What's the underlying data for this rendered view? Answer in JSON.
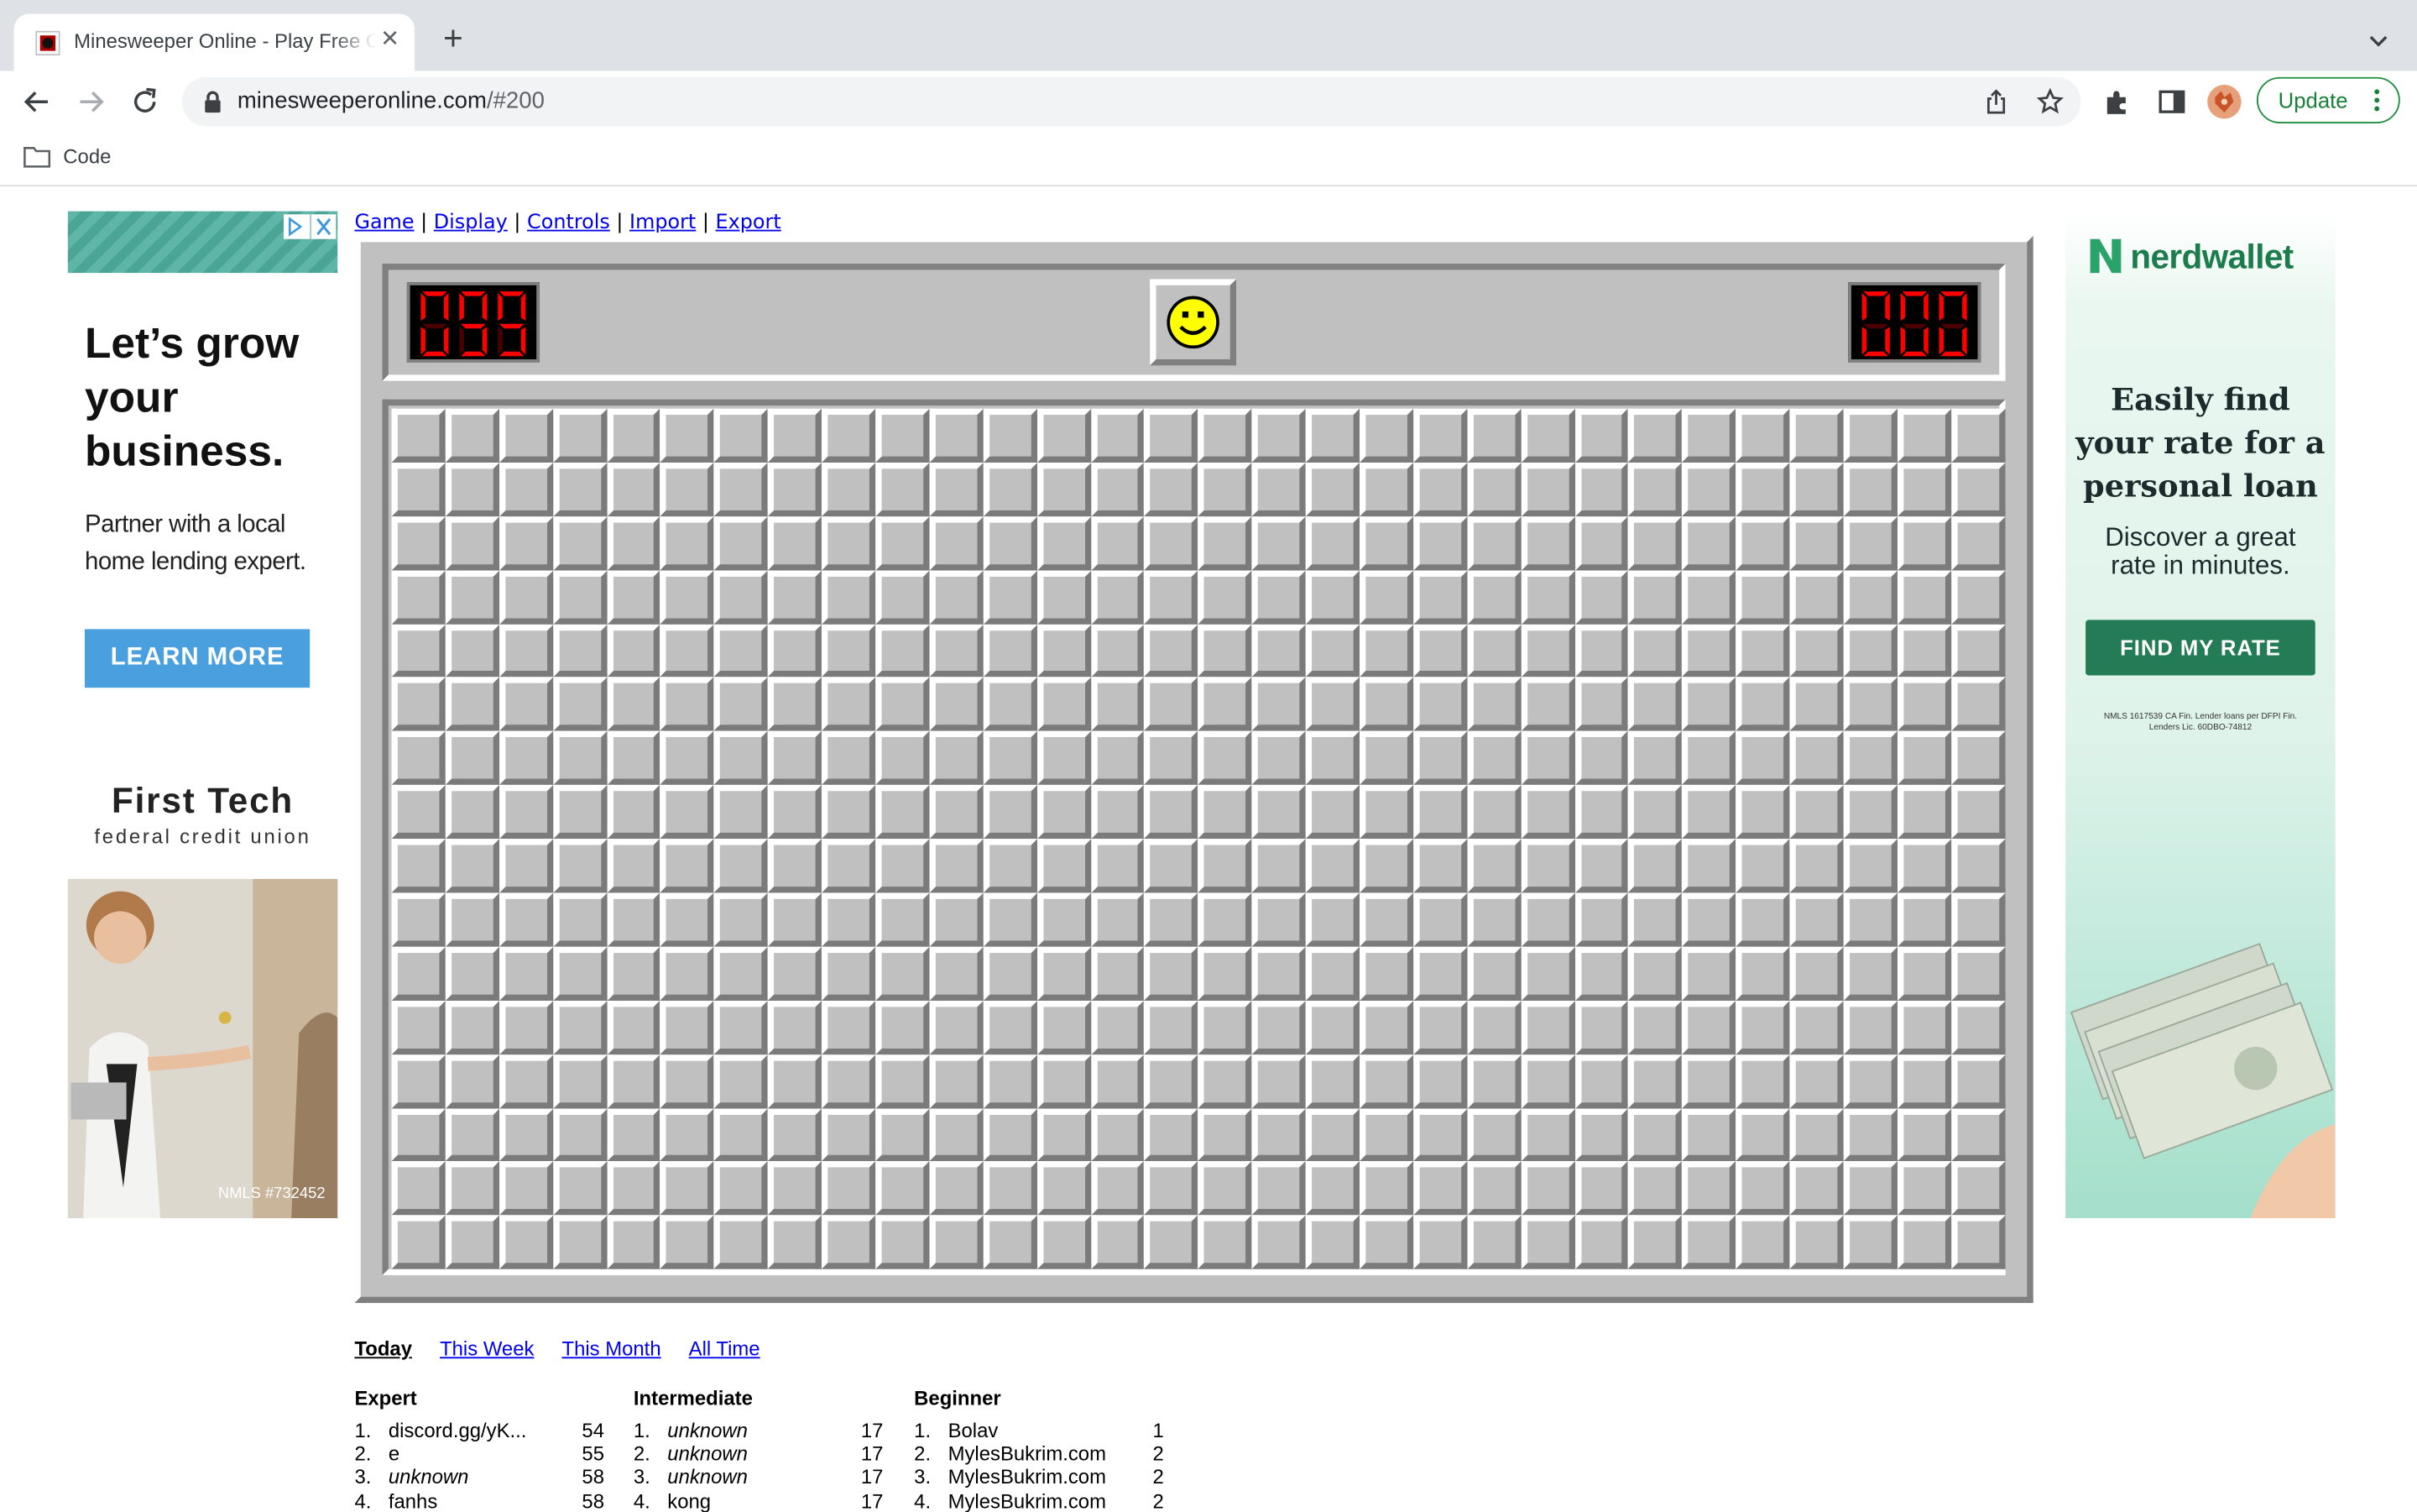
{
  "browser": {
    "tab_title": "Minesweeper Online - Play Free Online Minesweeper",
    "url_host": "minesweeperonline.com",
    "url_path": "/#200",
    "update_label": "Update",
    "bookmark_folder": "Code"
  },
  "ads": {
    "left_headline": "Let’s grow your business.",
    "left_body": "Partner with a local home lending expert.",
    "left_cta": "LEARN MORE",
    "left_brand": "First Tech",
    "left_brand_sub": "federal credit union",
    "left_nmls": "NMLS #732452",
    "right_brand": "nerdwallet",
    "right_headline": "Easily find your rate for a personal loan",
    "right_sub": "Discover a great rate in minutes.",
    "right_cta": "FIND MY RATE",
    "right_fine": "NMLS 1617539 CA Fin. Lender loans per DFPI Fin. Lenders Lic. 60DBO-74812"
  },
  "menu": {
    "items": [
      "Game",
      "Display",
      "Controls",
      "Import",
      "Export"
    ],
    "separator": " | "
  },
  "game": {
    "mines_counter": "099",
    "timer": "000",
    "face": "smile",
    "columns": 30,
    "rows": 16,
    "colors": {
      "face_yellow": "#ffff00",
      "led_red": "#ff0000",
      "panel_gray": "#c0c0c0"
    }
  },
  "leaderboard": {
    "periods": [
      "Today",
      "This Week",
      "This Month",
      "All Time"
    ],
    "active_period": "Today",
    "columns": [
      {
        "title": "Expert",
        "rows": [
          {
            "rank": "1.",
            "name": "discord.gg/yK...",
            "time": "54",
            "italic": false
          },
          {
            "rank": "2.",
            "name": "e",
            "time": "55",
            "italic": false
          },
          {
            "rank": "3.",
            "name": "unknown",
            "time": "58",
            "italic": true
          },
          {
            "rank": "4.",
            "name": "fanhs",
            "time": "58",
            "italic": false
          }
        ]
      },
      {
        "title": "Intermediate",
        "rows": [
          {
            "rank": "1.",
            "name": "unknown",
            "time": "17",
            "italic": true
          },
          {
            "rank": "2.",
            "name": "unknown",
            "time": "17",
            "italic": true
          },
          {
            "rank": "3.",
            "name": "unknown",
            "time": "17",
            "italic": true
          },
          {
            "rank": "4.",
            "name": "kong",
            "time": "17",
            "italic": false
          }
        ]
      },
      {
        "title": "Beginner",
        "rows": [
          {
            "rank": "1.",
            "name": "Bolav",
            "time": "1",
            "italic": false
          },
          {
            "rank": "2.",
            "name": "MylesBukrim.com",
            "time": "2",
            "italic": false
          },
          {
            "rank": "3.",
            "name": "MylesBukrim.com",
            "time": "2",
            "italic": false
          },
          {
            "rank": "4.",
            "name": "MylesBukrim.com",
            "time": "2",
            "italic": false
          }
        ]
      }
    ]
  }
}
